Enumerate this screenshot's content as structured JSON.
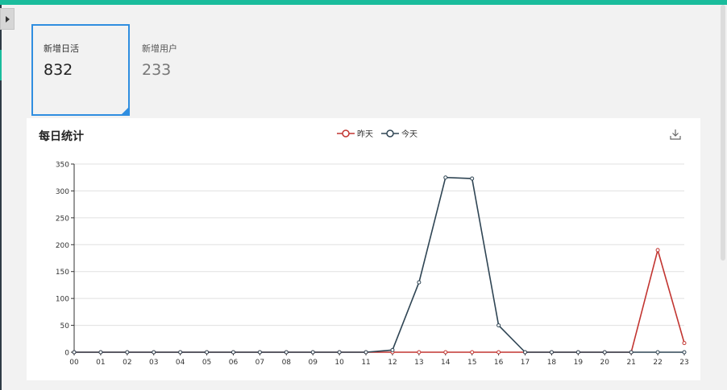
{
  "cards": [
    {
      "label": "新增日活",
      "value": "832"
    },
    {
      "label": "新增用户",
      "value": "233"
    }
  ],
  "panel": {
    "title": "每日统计"
  },
  "colors": {
    "accent": "#1abc9c",
    "active_border": "#2f8ee0",
    "yesterday": "#c23531",
    "today": "#2f4554"
  },
  "chart_data": {
    "type": "line",
    "title": "每日统计",
    "xlabel": "",
    "ylabel": "",
    "ylim": [
      0,
      350
    ],
    "yticks": [
      0,
      50,
      100,
      150,
      200,
      250,
      300,
      350
    ],
    "categories": [
      "00",
      "01",
      "02",
      "03",
      "04",
      "05",
      "06",
      "07",
      "08",
      "09",
      "10",
      "11",
      "12",
      "13",
      "14",
      "15",
      "16",
      "17",
      "18",
      "19",
      "20",
      "21",
      "22",
      "23"
    ],
    "series": [
      {
        "name": "昨天",
        "color": "#c23531",
        "values": [
          0,
          0,
          0,
          0,
          0,
          0,
          0,
          0,
          0,
          0,
          0,
          0,
          0,
          0,
          0,
          0,
          0,
          0,
          0,
          0,
          0,
          0,
          190,
          17
        ]
      },
      {
        "name": "今天",
        "color": "#2f4554",
        "values": [
          0,
          0,
          0,
          0,
          0,
          0,
          0,
          0,
          0,
          0,
          0,
          0,
          4,
          130,
          325,
          323,
          50,
          0,
          0,
          0,
          0,
          0,
          0,
          0
        ]
      }
    ],
    "grid": true,
    "legend_position": "top-center"
  }
}
